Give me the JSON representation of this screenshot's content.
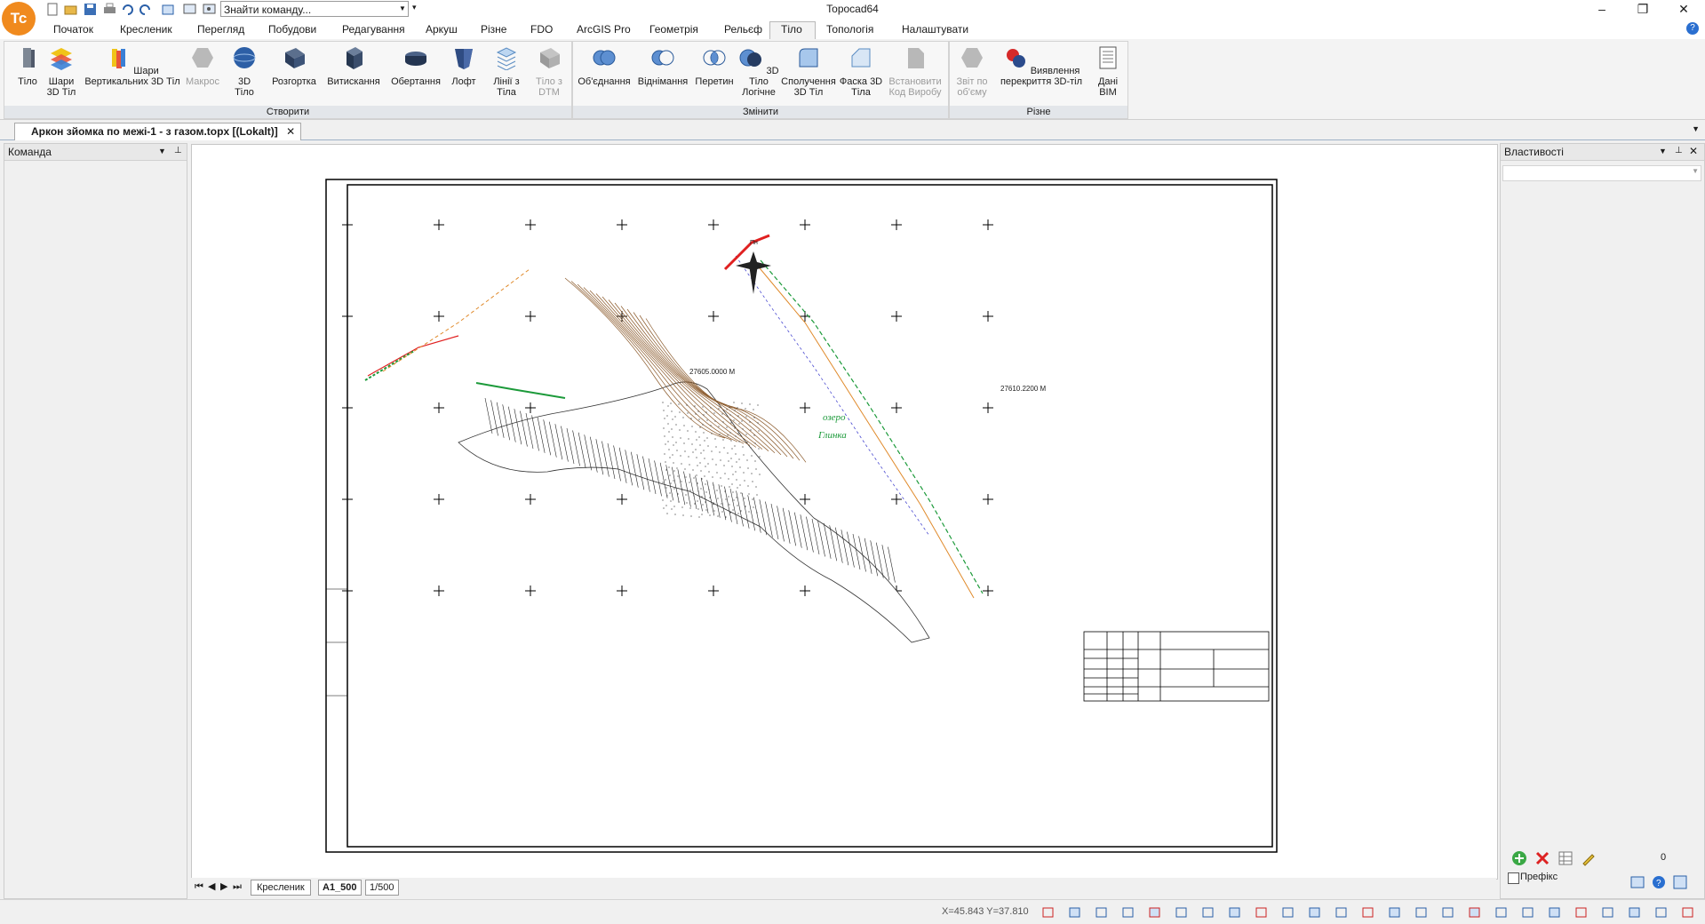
{
  "window": {
    "title": "Topocad64",
    "minimize": "–",
    "maximize": "❐",
    "close": "✕"
  },
  "quick_access": {
    "search_placeholder": "Знайти команду..."
  },
  "menu_tabs": [
    "Початок",
    "Кресленик",
    "Перегляд",
    "Побудови",
    "Редагування",
    "Аркуш",
    "Різне",
    "FDO",
    "ArcGIS Pro",
    "Геометрія",
    "Рельєф",
    "Тіло",
    "Топологія",
    "Налаштувати"
  ],
  "active_tab": "Тіло",
  "ribbon": {
    "groups": [
      {
        "label": "Створити",
        "buttons": [
          {
            "label": "Тіло",
            "icon": "solid-icon"
          },
          {
            "label": "Шари 3D Тіл",
            "icon": "layers-3d-icon"
          },
          {
            "label": "Шари Вертикальних 3D Тіл",
            "icon": "vertical-layers-icon"
          },
          {
            "label": "Макрос",
            "icon": "macro-icon"
          },
          {
            "label": "3D Тіло",
            "icon": "sphere-icon"
          },
          {
            "label": "Розгортка",
            "icon": "unfold-icon"
          },
          {
            "label": "Витискання",
            "icon": "extrude-icon"
          },
          {
            "label": "Обертання",
            "icon": "revolve-icon"
          },
          {
            "label": "Лофт",
            "icon": "loft-icon"
          },
          {
            "label": "Лінії з Тіла",
            "icon": "lines-from-solid-icon"
          },
          {
            "label": "Тіло з DTM",
            "icon": "solid-from-dtm-icon"
          }
        ]
      },
      {
        "label": "Змінити",
        "buttons": [
          {
            "label": "Об'єднання",
            "icon": "union-icon"
          },
          {
            "label": "Віднімання",
            "icon": "subtract-icon"
          },
          {
            "label": "Перетин",
            "icon": "intersect-icon"
          },
          {
            "label": "3D Тіло Логічне",
            "icon": "boolean-icon"
          },
          {
            "label": "Сполучення 3D Тіл",
            "icon": "fillet-icon"
          },
          {
            "label": "Фаска 3D Тіла",
            "icon": "chamfer-icon"
          },
          {
            "label": "Встановити Код Виробу",
            "icon": "product-code-icon"
          }
        ]
      },
      {
        "label": "Різне",
        "buttons": [
          {
            "label": "Звіт по об'єму",
            "icon": "volume-report-icon"
          },
          {
            "label": "Виявлення перекриття 3D-тіл",
            "icon": "overlap-detect-icon"
          },
          {
            "label": "Дані BIM",
            "icon": "bim-data-icon"
          }
        ]
      }
    ]
  },
  "document_tab": "Аркон зйомка по межі-1 - з газом.topx [(Lokalt)]",
  "left_pane": {
    "title": "Команда"
  },
  "right_pane": {
    "title": "Властивості",
    "prefix_label": "Префікс",
    "count": "0"
  },
  "drawing": {
    "lake_label_1": "озеро",
    "lake_label_2": "Глинка",
    "north_label": "Пн",
    "coord_label_1": "27610.2200 М",
    "coord_label_2": "27605.0000 М"
  },
  "sheet_tabs": [
    "Кресленик",
    "A1_500",
    "1/500"
  ],
  "active_sheet": "A1_500",
  "status": {
    "coords": "X=45.843 Y=37.810"
  },
  "colors": {
    "accent": "#f08a1e",
    "ribbon_bg": "#f3f3f3",
    "contour_brown": "#8b5a2b",
    "road_red": "#e02020",
    "green_line": "#1c9a3a"
  }
}
